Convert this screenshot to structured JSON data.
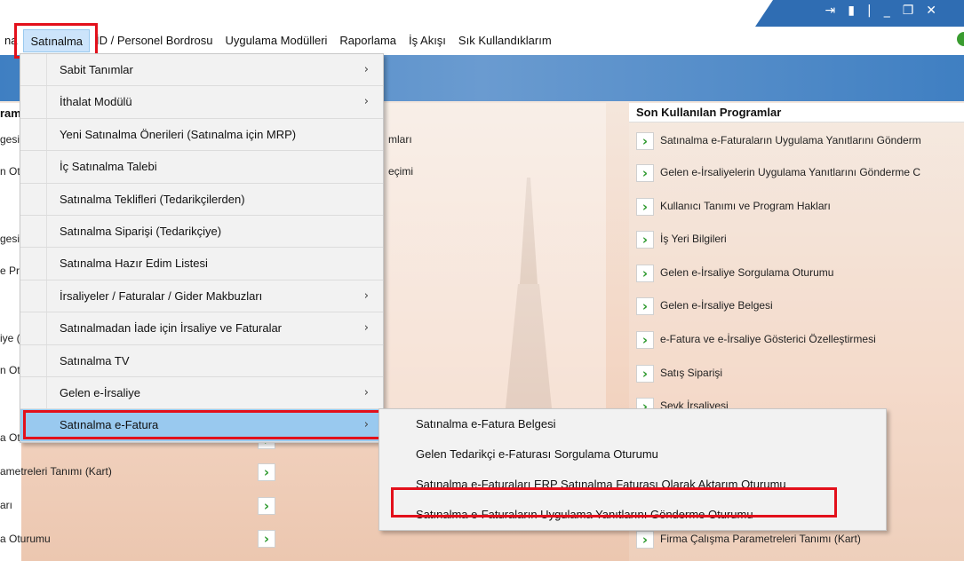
{
  "window": {
    "icons": [
      "pin-icon",
      "signal-icon",
      "separator",
      "minimize-icon",
      "restore-icon",
      "close-icon"
    ]
  },
  "menubar": {
    "items": [
      {
        "label": "na"
      },
      {
        "label": "Satınalma"
      },
      {
        "label": "İD / Personel Bordrosu"
      },
      {
        "label": "Uygulama Modülleri"
      },
      {
        "label": "Raporlama"
      },
      {
        "label": "İş Akışı"
      },
      {
        "label": "Sık Kullandıklarım"
      }
    ]
  },
  "dropdown": {
    "items": [
      {
        "label": "Sabit Tanımlar",
        "arrow": "›"
      },
      {
        "label": "İthalat Modülü",
        "arrow": "›"
      },
      {
        "label": "Yeni Satınalma Önerileri (Satınalma için MRP)",
        "arrow": ""
      },
      {
        "label": "İç Satınalma Talebi",
        "arrow": ""
      },
      {
        "label": "Satınalma Teklifleri (Tedarikçilerden)",
        "arrow": ""
      },
      {
        "label": "Satınalma Siparişi (Tedarikçiye)",
        "arrow": ""
      },
      {
        "label": "Satınalma Hazır Edim Listesi",
        "arrow": ""
      },
      {
        "label": "İrsaliyeler / Faturalar / Gider Makbuzları",
        "arrow": "›"
      },
      {
        "label": "Satınalmadan İade için İrsaliye ve Faturalar",
        "arrow": "›"
      },
      {
        "label": "Satınalma TV",
        "arrow": ""
      },
      {
        "label": "Gelen e-İrsaliye",
        "arrow": "›"
      },
      {
        "label": "Satınalma e-Fatura",
        "arrow": "›"
      }
    ]
  },
  "submenu": {
    "items": [
      {
        "label": "Satınalma e-Fatura Belgesi"
      },
      {
        "label": "Gelen Tedarikçi e-Faturası Sorgulama Oturumu"
      },
      {
        "label": "Satınalma e-Faturaları ERP Satınalma Faturası Olarak Aktarım Oturumu"
      },
      {
        "label": "Satınalma e-Faturaların Uygulama Yanıtlarını Gönderme Oturumu"
      }
    ]
  },
  "left_panel": {
    "header": "ram",
    "rows": [
      "gesi",
      "n Ot",
      "gesi",
      "e Pr",
      "iye (",
      "n Ot",
      "a Oturumu",
      "ametreleri Tanımı (Kart)",
      "arı",
      "a Oturumu"
    ]
  },
  "center_panel": {
    "rows": [
      "mları",
      "eçimi"
    ]
  },
  "right_panel": {
    "title": "Son Kullanılan Programlar",
    "items": [
      "Satınalma e-Faturaların Uygulama Yanıtlarını Gönderm",
      "Gelen e-İrsaliyelerin Uygulama Yanıtlarını Gönderme C",
      "Kullanıcı Tanımı ve Program Hakları",
      "İş Yeri Bilgileri",
      "Gelen e-İrsaliye Sorgulama Oturumu",
      "Gelen e-İrsaliye Belgesi",
      "e-Fatura ve e-İrsaliye Gösterici Özelleştirmesi",
      "Satış Siparişi",
      "Sevk İrsaliyesi",
      "Firma Çalışma Parametreleri Tanımı (Kart)"
    ]
  },
  "glyphs": {
    "chevron": "›",
    "green_chevron": "›"
  },
  "colors": {
    "accent": "#99c9ef",
    "highlight_box": "#e3101b",
    "titlebar": "#2f6db3",
    "chevron": "#2e9a2e"
  }
}
